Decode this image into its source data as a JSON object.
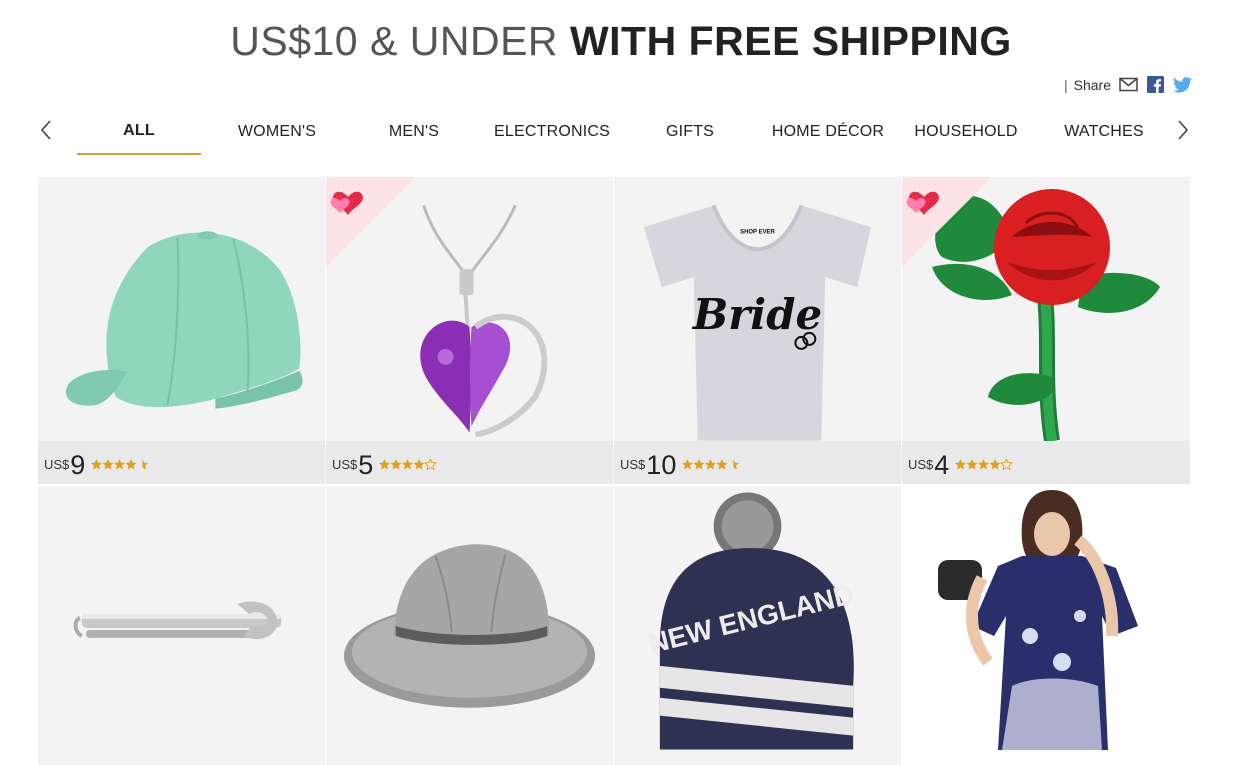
{
  "header": {
    "title_light": "US$10 & UNDER",
    "title_bold": "WITH FREE SHIPPING"
  },
  "share": {
    "separator": "|",
    "label": "Share",
    "icons": [
      "mail-icon",
      "facebook-icon",
      "twitter-icon"
    ]
  },
  "nav": {
    "prev_icon": "chevron-left-icon",
    "next_icon": "chevron-right-icon",
    "tabs": [
      {
        "label": "ALL",
        "active": true
      },
      {
        "label": "WOMEN'S",
        "active": false
      },
      {
        "label": "MEN'S",
        "active": false
      },
      {
        "label": "ELECTRONICS",
        "active": false
      },
      {
        "label": "GIFTS",
        "active": false
      },
      {
        "label": "HOME DÉCOR",
        "active": false
      },
      {
        "label": "HOUSEHOLD",
        "active": false
      },
      {
        "label": "WATCHES",
        "active": false
      }
    ]
  },
  "colors": {
    "tab_underline": "#d29d3c",
    "star": "#e0a21a",
    "card_bg": "#f3f3f3",
    "price_bar_bg": "#e9e9e9"
  },
  "products": [
    {
      "image": "mint baseball cap",
      "currency": "US$",
      "price": "9",
      "rating": 4.5,
      "badge": false
    },
    {
      "image": "purple heart pendant necklace",
      "currency": "US$",
      "price": "5",
      "rating": 4,
      "badge": true
    },
    {
      "image": "Bride v-neck t-shirt",
      "currency": "US$",
      "price": "10",
      "rating": 4.5,
      "badge": false
    },
    {
      "image": "red rose embroidered patch",
      "currency": "US$",
      "price": "4",
      "rating": 4,
      "badge": true
    },
    {
      "image": "wrench tie clip",
      "currency": "",
      "price": "",
      "rating": null,
      "badge": false
    },
    {
      "image": "grey fedora hat",
      "currency": "",
      "price": "",
      "rating": null,
      "badge": false
    },
    {
      "image": "New England knit beanie",
      "currency": "",
      "price": "",
      "rating": null,
      "badge": false
    },
    {
      "image": "floral print tunic dress",
      "currency": "",
      "price": "",
      "rating": null,
      "badge": false
    }
  ],
  "shirt_print": {
    "brand": "SHOP EVER",
    "word": "Bride"
  },
  "beanie_print": "NEW ENGLAND"
}
